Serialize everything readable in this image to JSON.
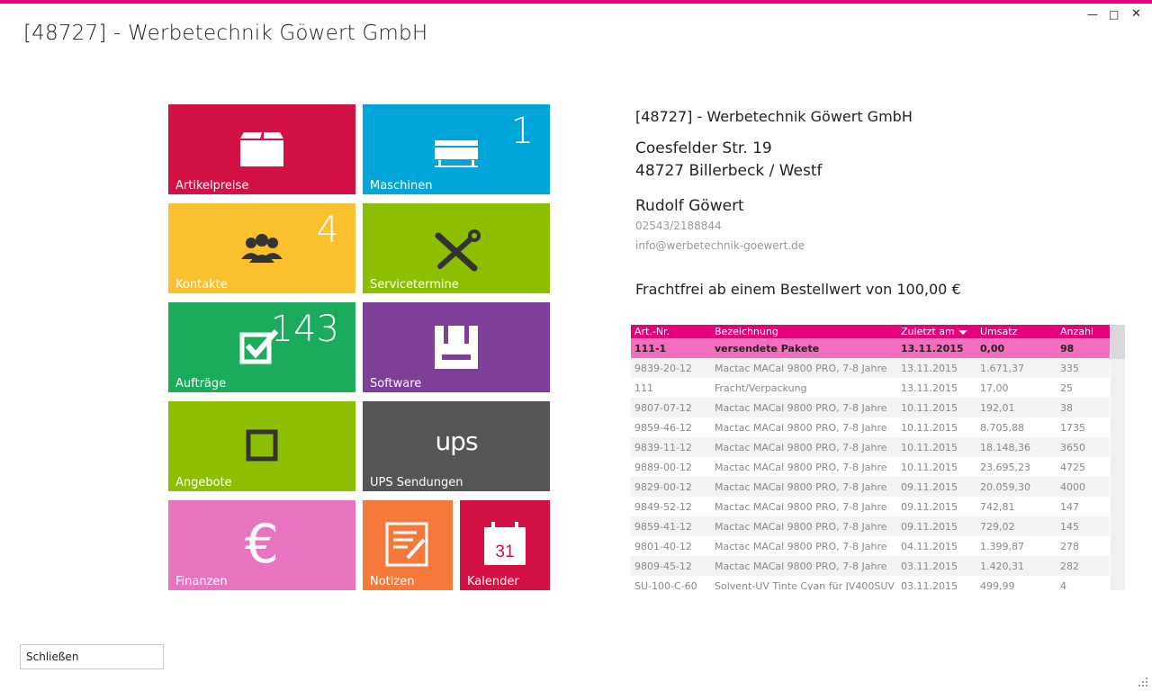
{
  "window": {
    "title": "[48727] - Werbetechnik Göwert GmbH",
    "accent": "#e6007e"
  },
  "tiles": {
    "artikelpreise": {
      "label": "Artikelpreise",
      "color": "#d41145"
    },
    "maschinen": {
      "label": "Maschinen",
      "count": "1",
      "color": "#00a6d9"
    },
    "kontakte": {
      "label": "Kontakte",
      "count": "4",
      "color": "#fbc02d"
    },
    "servicetermine": {
      "label": "Servicetermine",
      "color": "#8cbf00"
    },
    "auftraege": {
      "label": "Aufträge",
      "count": "143",
      "color": "#1aab5d"
    },
    "software": {
      "label": "Software",
      "color": "#7e3f98"
    },
    "angebote": {
      "label": "Angebote",
      "color": "#8cbf00"
    },
    "ups": {
      "label": "UPS Sendungen",
      "logo": "ups",
      "color": "#555555"
    },
    "finanzen": {
      "label": "Finanzen",
      "symbol": "€",
      "color": "#e874bf"
    },
    "notizen": {
      "label": "Notizen",
      "color": "#f5793a"
    },
    "kalender": {
      "label": "Kalender",
      "day": "31",
      "color": "#d41145"
    }
  },
  "customer": {
    "name": "[48727] - Werbetechnik Göwert GmbH",
    "street": "Coesfelder Str. 19",
    "city": "48727 Billerbeck / Westf",
    "contact": "Rudolf Göwert",
    "phone": "02543/2188844",
    "email": "info@werbetechnik-goewert.de",
    "shipping_note": "Frachtfrei ab einem Bestellwert von 100,00 €"
  },
  "orders_table": {
    "columns": [
      "Art.-Nr.",
      "Bezeichnung",
      "Zuletzt am",
      "Umsatz",
      "Anzahl"
    ],
    "sort_column": "Zuletzt am",
    "selected_row": 0,
    "rows": [
      [
        "111-1",
        "versendete Pakete",
        "13.11.2015",
        "0,00",
        "98"
      ],
      [
        "9839-20-12",
        "Mactac MACal 9800 PRO, 7-8 Jahre",
        "13.11.2015",
        "1.671,37",
        "335"
      ],
      [
        "111",
        "Fracht/Verpackung",
        "13.11.2015",
        "17,00",
        "25"
      ],
      [
        "9807-07-12",
        "Mactac MACal 9800 PRO, 7-8 Jahre",
        "10.11.2015",
        "192,01",
        "38"
      ],
      [
        "9859-46-12",
        "Mactac MACal 9800 PRO, 7-8 Jahre",
        "10.11.2015",
        "8.705,88",
        "1735"
      ],
      [
        "9839-11-12",
        "Mactac MACal 9800 PRO, 7-8 Jahre",
        "10.11.2015",
        "18.148,36",
        "3650"
      ],
      [
        "9889-00-12",
        "Mactac MACal 9800 PRO, 7-8 Jahre",
        "10.11.2015",
        "23.695,23",
        "4725"
      ],
      [
        "9829-00-12",
        "Mactac MACal 9800 PRO, 7-8 Jahre",
        "09.11.2015",
        "20.059,30",
        "4000"
      ],
      [
        "9849-52-12",
        "Mactac MACal 9800 PRO, 7-8 Jahre",
        "09.11.2015",
        "742,81",
        "147"
      ],
      [
        "9859-41-12",
        "Mactac MACal 9800 PRO, 7-8 Jahre",
        "09.11.2015",
        "729,02",
        "145"
      ],
      [
        "9801-40-12",
        "Mactac MACal 9800 PRO, 7-8 Jahre",
        "04.11.2015",
        "1.399,87",
        "278"
      ],
      [
        "9809-45-12",
        "Mactac MACal 9800 PRO, 7-8 Jahre",
        "03.11.2015",
        "1.420,31",
        "282"
      ],
      [
        "SU-100-C-60",
        "Solvent-UV Tinte Cyan für JV400SUV",
        "03.11.2015",
        "499,99",
        "4"
      ]
    ]
  },
  "footer": {
    "close_label": "Schließen"
  }
}
